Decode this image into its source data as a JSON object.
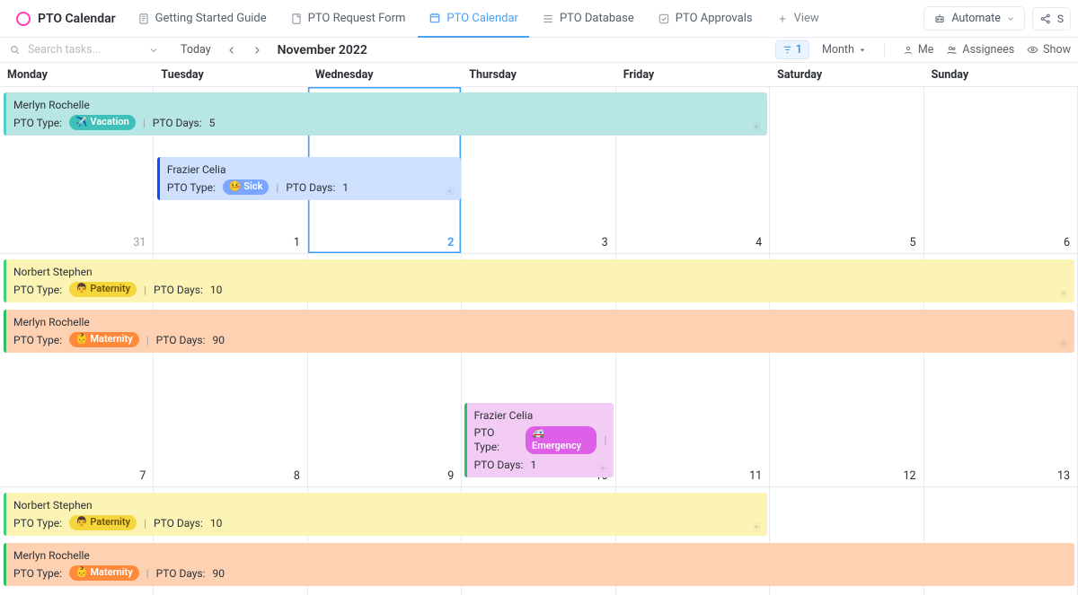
{
  "header": {
    "title": "PTO Calendar",
    "tabs": [
      {
        "label": "Getting Started Guide"
      },
      {
        "label": "PTO Request Form"
      },
      {
        "label": "PTO Calendar"
      },
      {
        "label": "PTO Database"
      },
      {
        "label": "PTO Approvals"
      }
    ],
    "add_view": "View",
    "automate": "Automate"
  },
  "toolbar": {
    "search_placeholder": "Search tasks...",
    "today": "Today",
    "month_title": "November 2022",
    "filter_count": "1",
    "view_mode": "Month",
    "me": "Me",
    "assignees": "Assignees",
    "show": "Show"
  },
  "days": [
    "Monday",
    "Tuesday",
    "Wednesday",
    "Thursday",
    "Friday",
    "Saturday",
    "Sunday"
  ],
  "grid": {
    "week1": [
      "31",
      "1",
      "2",
      "3",
      "4",
      "5",
      "6"
    ],
    "week2": [
      "7",
      "8",
      "9",
      "10",
      "11",
      "12",
      "13"
    ]
  },
  "labels": {
    "pto_type": "PTO Type:",
    "pto_days": "PTO Days:"
  },
  "events": {
    "w1": [
      {
        "name": "Merlyn Rochelle",
        "type_emoji": "✈️",
        "type": "Vacation",
        "days": "5",
        "cls": "ev-vacation",
        "chip": "chip-vacation",
        "col": "col-0",
        "span": "span-5",
        "gear": true
      },
      {
        "name": "Frazier Celia",
        "type_emoji": "🤒",
        "type": "Sick",
        "days": "1",
        "cls": "ev-sick",
        "chip": "chip-sick",
        "col": "col-1",
        "span": "span-2",
        "gear": true
      }
    ],
    "w2a": [
      {
        "name": "Norbert Stephen",
        "type_emoji": "👨",
        "type": "Paternity",
        "days": "10",
        "cls": "ev-paternity",
        "chip": "chip-paternity",
        "col": "col-0",
        "span": "span-7",
        "gear": true
      },
      {
        "name": "Merlyn Rochelle",
        "type_emoji": "👶",
        "type": "Maternity",
        "days": "90",
        "cls": "ev-maternity",
        "chip": "chip-maternity",
        "col": "col-0",
        "span": "span-7",
        "gear": true
      },
      {
        "name": "Frazier Celia",
        "type_emoji": "🚑",
        "type": "Emergency",
        "days": "1",
        "cls": "ev-emergency",
        "chip": "chip-emergency",
        "col": "col-3",
        "span": "span-1",
        "gear": true,
        "stack": true
      }
    ],
    "w2b": [
      {
        "name": "Norbert Stephen",
        "type_emoji": "👨",
        "type": "Paternity",
        "days": "10",
        "cls": "ev-paternity",
        "chip": "chip-paternity",
        "col": "col-0",
        "span": "span-5",
        "gear": true
      },
      {
        "name": "Merlyn Rochelle",
        "type_emoji": "👶",
        "type": "Maternity",
        "days": "90",
        "cls": "ev-maternity",
        "chip": "chip-maternity",
        "col": "col-0",
        "span": "span-7",
        "gear": false
      }
    ]
  }
}
